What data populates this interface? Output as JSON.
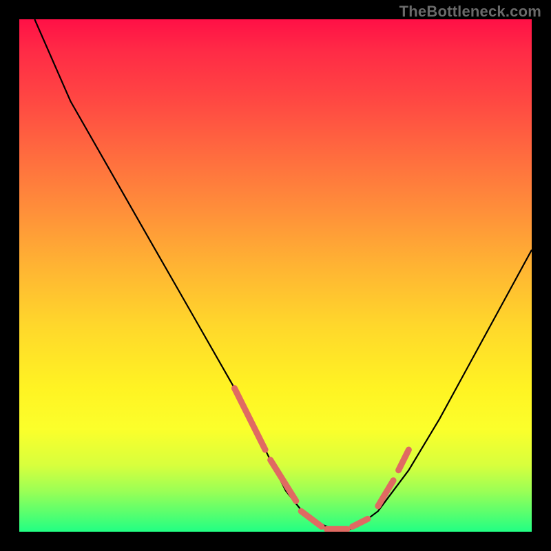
{
  "watermark": "TheBottleneck.com",
  "chart_data": {
    "type": "line",
    "title": "",
    "xlabel": "",
    "ylabel": "",
    "xlim": [
      0,
      100
    ],
    "ylim": [
      0,
      100
    ],
    "grid": false,
    "series": [
      {
        "name": "main-curve",
        "color": "#000000",
        "x": [
          3,
          10,
          18,
          26,
          34,
          42,
          48,
          52,
          56,
          60,
          63,
          66,
          70,
          76,
          82,
          88,
          94,
          100
        ],
        "y": [
          100,
          84,
          70,
          56,
          42,
          28,
          16,
          8,
          3,
          1,
          0,
          1,
          4,
          12,
          22,
          33,
          44,
          55
        ]
      },
      {
        "name": "highlight-dashes",
        "color": "#e06a62",
        "style": "dashed",
        "segments": [
          {
            "x0": 42,
            "y0": 28,
            "x1": 48,
            "y1": 16
          },
          {
            "x0": 49,
            "y0": 14,
            "x1": 54,
            "y1": 6
          },
          {
            "x0": 55,
            "y0": 4,
            "x1": 59,
            "y1": 1
          },
          {
            "x0": 60,
            "y0": 0.5,
            "x1": 64,
            "y1": 0.5
          },
          {
            "x0": 65,
            "y0": 1,
            "x1": 68,
            "y1": 2.5
          },
          {
            "x0": 70,
            "y0": 5,
            "x1": 73,
            "y1": 10
          },
          {
            "x0": 74,
            "y0": 12,
            "x1": 76,
            "y1": 16
          }
        ]
      }
    ],
    "colors": {
      "gradient_top": "#ff1046",
      "gradient_mid": "#ffd82b",
      "gradient_bottom": "#22ff84",
      "curve": "#000000",
      "highlight": "#e06a62",
      "frame": "#000000"
    }
  }
}
